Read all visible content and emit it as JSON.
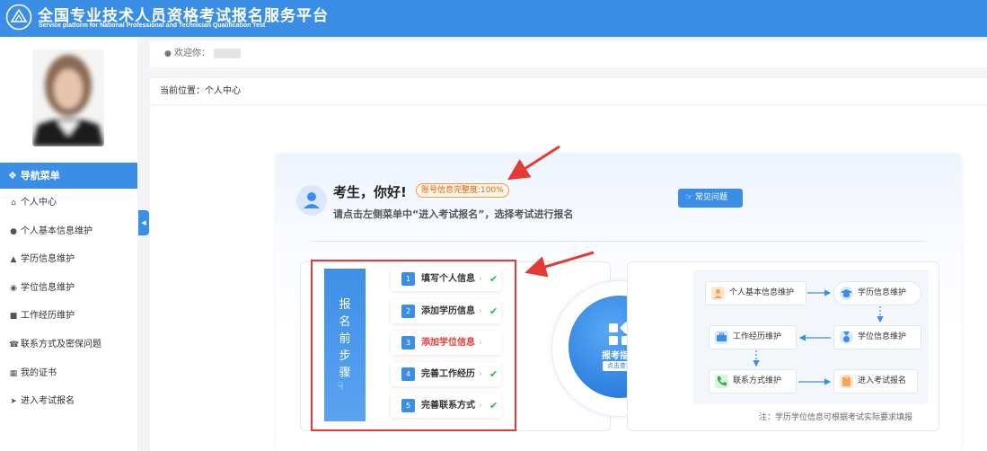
{
  "header": {
    "title": "全国专业技术人员资格考试报名服务平台",
    "subtitle": "Service platform for National Professional and Technician Qualification Test",
    "logo_text": "PTA"
  },
  "sidebar": {
    "nav_header": "导航菜单",
    "items": [
      {
        "label": "个人中心",
        "icon": "home-icon"
      },
      {
        "label": "个人基本信息维护",
        "icon": "user-icon"
      },
      {
        "label": "学历信息维护",
        "icon": "graduation-cap-icon"
      },
      {
        "label": "学位信息维护",
        "icon": "medal-icon"
      },
      {
        "label": "工作经历维护",
        "icon": "briefcase-icon"
      },
      {
        "label": "联系方式及密保问题",
        "icon": "phone-icon"
      },
      {
        "label": "我的证书",
        "icon": "book-icon"
      },
      {
        "label": "进入考试报名",
        "icon": "arrow-circle-icon"
      }
    ]
  },
  "userbar": {
    "welcome": "欢迎你："
  },
  "breadcrumb": {
    "text": "当前位置：个人中心"
  },
  "greeting": {
    "title": "考生，你好!",
    "badge": "账号信息完整度:100%",
    "subtitle": "请点击左侧菜单中“进入考试报名”，选择考试进行报名",
    "faq_button": "常见问题"
  },
  "steps": {
    "panel_title_chars": [
      "报",
      "名",
      "前",
      "步",
      "骤"
    ],
    "items": [
      {
        "num": "1",
        "label": "填写个人信息",
        "done": true,
        "check": "✔"
      },
      {
        "num": "2",
        "label": "添加学历信息",
        "done": true,
        "check": "✔"
      },
      {
        "num": "3",
        "label": "添加学位信息",
        "done": false,
        "check": ""
      },
      {
        "num": "4",
        "label": "完善工作经历",
        "done": true,
        "check": "✔"
      },
      {
        "num": "5",
        "label": "完善联系方式",
        "done": true,
        "check": "✔"
      }
    ],
    "chevron": "›"
  },
  "guide": {
    "label": "报考指南",
    "click": "点击查看"
  },
  "flow": {
    "nodes": [
      {
        "label": "个人基本信息维护",
        "icon": "user-icon",
        "color": "#f7a35c"
      },
      {
        "label": "学历信息维护",
        "icon": "graduation-cap-icon",
        "color": "#3a8ee6"
      },
      {
        "label": "工作经历维护",
        "icon": "briefcase-icon",
        "color": "#3a8ee6"
      },
      {
        "label": "学位信息维护",
        "icon": "medal-icon",
        "color": "#3a8ee6"
      },
      {
        "label": "联系方式维护",
        "icon": "phone-icon",
        "color": "#2fb344"
      },
      {
        "label": "进入考试报名",
        "icon": "clipboard-icon",
        "color": "#f7a35c"
      }
    ],
    "note": "注：学历学位信息可根据考试实际要求填报"
  },
  "colors": {
    "primary": "#3a8ee6",
    "alert": "#e53935",
    "success": "#2fb344",
    "badge": "#e0620d"
  }
}
